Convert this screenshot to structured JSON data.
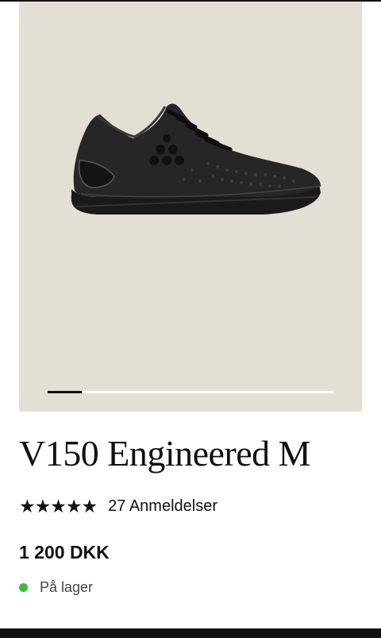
{
  "product": {
    "name": "V150 Engineered M",
    "rating": 5,
    "rating_max": 5,
    "reviews_label": "27 Anmeldelser",
    "price": "1 200 DKK",
    "stock_label": "På lager"
  },
  "gallery": {
    "image_icon": "running-shoe-icon",
    "background_color": "#e4dfd5",
    "progress": 0.12
  },
  "colors": {
    "stock_indicator": "#3dbb3f",
    "text": "#111111"
  }
}
